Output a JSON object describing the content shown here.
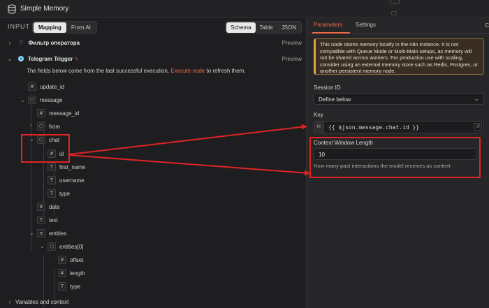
{
  "window": {
    "title": "Simple Memory"
  },
  "input_panel": {
    "label": "INPUT",
    "mode_tabs": [
      "Mapping",
      "From AI"
    ],
    "view_tabs": [
      "Schema",
      "Table",
      "JSON"
    ],
    "nodes": [
      {
        "name": "Фильтр оператора",
        "preview": "Preview"
      },
      {
        "name": "Telegram Trigger",
        "preview": "Preview"
      }
    ],
    "info_prefix": "The fields below come from the last successful execution.",
    "info_link": "Execute node",
    "info_suffix": "to refresh them.",
    "fields": {
      "update_id": "update_id",
      "message": "message",
      "message_id": "message_id",
      "from": "from",
      "chat": "chat",
      "id": "id",
      "first_name": "first_name",
      "username": "username",
      "type": "type",
      "date": "date",
      "text": "text",
      "entities": "entities",
      "entities0": "entities[0]",
      "offset": "offset",
      "length": "length",
      "type2": "type"
    },
    "bottom_section": "Variables and context"
  },
  "params_panel": {
    "tabs": [
      "Parameters",
      "Settings"
    ],
    "notice": "This node stores memory locally in the n8n instance. It is not compatible with Queue Mode or Multi-Main setups, as memory will not be shared across workers. For production use with scaling, consider using an external memory store such as Redis, Postgres, or another persistent memory node.",
    "session_id_label": "Session ID",
    "session_id_value": "Define below",
    "key_label": "Key",
    "key_value": "{{ $json.message.chat.id }}",
    "context_label": "Context Window Length",
    "context_value": "10",
    "context_hint": "How many past interactions the model receives as context",
    "edge_letter": "C"
  },
  "colors": {
    "accent": "#ee6a48",
    "annotation": "#e02424",
    "notice_border": "#d9a44b"
  }
}
